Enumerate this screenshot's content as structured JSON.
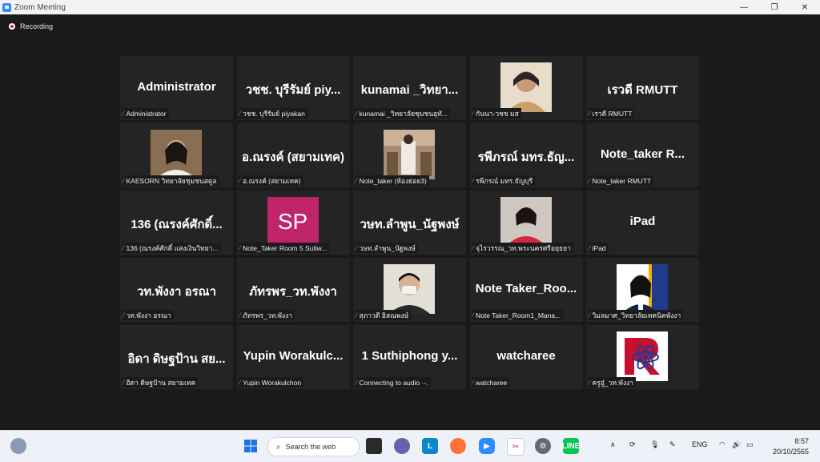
{
  "window": {
    "title": "Zoom Meeting"
  },
  "recording": {
    "label": "Recording"
  },
  "tiles": [
    {
      "big": "Administrator",
      "label": "Administrator",
      "kind": "name"
    },
    {
      "big": "วชช. บุรีรัมย์ piy...",
      "label": "วชช. บุรีรัมย์ piyakan",
      "kind": "name"
    },
    {
      "big": "kunamai _วิทยา...",
      "label": "kunamai _วิทยาลัยชุมชนอุทั...",
      "kind": "name"
    },
    {
      "big": "",
      "label": "กันนา-วชช มส",
      "kind": "photo-woman-older"
    },
    {
      "big": "เรวดี RMUTT",
      "label": "เรวดี RMUTT",
      "kind": "name"
    },
    {
      "big": "",
      "label": "KAESORN วิทยาลัยชุมชนสตูล",
      "kind": "photo-woman"
    },
    {
      "big": "อ.ณรงค์ (สยามเทค)",
      "label": "อ.ณรงค์ (สยามเทค)",
      "kind": "name"
    },
    {
      "big": "",
      "label": "Note_taker (ห้องย่อย3)",
      "kind": "photo-room"
    },
    {
      "big": "รพีภรณ์ มทร.ธัญ...",
      "label": "รพีภรณ์ มทร.ธัญบุรี",
      "kind": "name"
    },
    {
      "big": "Note_taker    R...",
      "label": "Note_taker    RMUTT",
      "kind": "name"
    },
    {
      "big": "136 (ณรงค์ศักดิ์...",
      "label": "136 (ณรงค์ศักดิ์ แสงเงินวิทยา...",
      "kind": "name"
    },
    {
      "big": "SP",
      "label": "Note_Taker Room 5 Sutiw...",
      "kind": "initials"
    },
    {
      "big": "วษท.ลำพูน_นัฐพงษ์",
      "label": "วษท.ลำพูน_นัฐพงษ์",
      "kind": "name"
    },
    {
      "big": "",
      "label": "จุไรวรรณ_วท.พระนครศรีอยุธยา",
      "kind": "photo-woman-red"
    },
    {
      "big": "iPad",
      "label": "iPad",
      "kind": "name"
    },
    {
      "big": "วท.พังงา อรณา",
      "label": "วท.พังงา อรณา",
      "kind": "name"
    },
    {
      "big": "ภัทรพร_วท.พังงา",
      "label": "ภัทรพร_วท.พังงา",
      "kind": "name"
    },
    {
      "big": "",
      "label": "สุภาวดี อิสณพงษ์",
      "kind": "photo-mask"
    },
    {
      "big": "Note Taker_Roo...",
      "label": "Note Taker_Room1_Mana...",
      "kind": "name"
    },
    {
      "big": "",
      "label": "วิมลมาศ_วิทยาลัยเทคนิคพังงา",
      "kind": "photo-student"
    },
    {
      "big": "อิดา ดิษฐป้าน สย...",
      "label": "อิดา ดิษฐป้าน สยามเทค",
      "kind": "name"
    },
    {
      "big": "Yupin Worakulc...",
      "label": "Yupin Worakulchon",
      "kind": "name"
    },
    {
      "big": "1 Suthiphong y...",
      "label": "Connecting to audio ·-.",
      "kind": "name"
    },
    {
      "big": "watcharee",
      "label": "watcharee",
      "kind": "name"
    },
    {
      "big": "",
      "label": "ครูอู๋_วท.พังงา",
      "kind": "logo"
    }
  ],
  "taskbar": {
    "search_placeholder": "Search the web",
    "language": "ENG",
    "time": "8:57",
    "date": "20/10/2565",
    "icons": [
      "weather-icon",
      "windows-start-icon",
      "search-icon",
      "file-explorer-icon",
      "teams-chat-icon",
      "line-l-icon",
      "firefox-icon",
      "zoom-icon",
      "snipping-tool-icon",
      "settings-icon",
      "line-app-icon"
    ]
  },
  "colors": {
    "accent": "#2d8cff",
    "sp_badge": "#c0246a",
    "mic_muted": "#e0403a"
  }
}
